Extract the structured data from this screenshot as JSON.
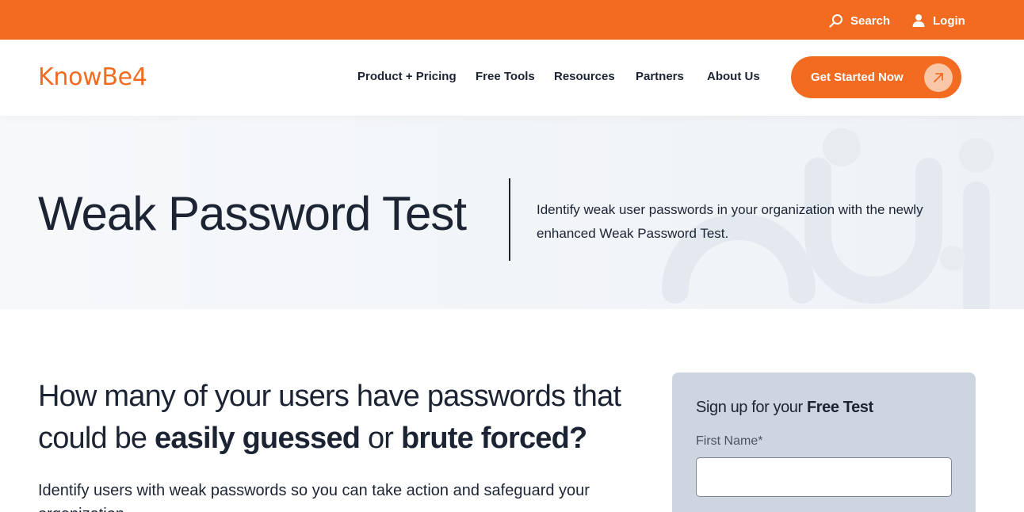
{
  "topbar": {
    "search_label": "Search",
    "login_label": "Login",
    "background": "#f26b21"
  },
  "header": {
    "logo_text": "KnowBe4",
    "nav": [
      {
        "label": "Product + Pricing"
      },
      {
        "label": "Free Tools"
      },
      {
        "label": "Resources"
      },
      {
        "label": "Partners"
      },
      {
        "label": "About Us"
      }
    ],
    "cta_label": "Get Started Now",
    "accent": "#f26b21"
  },
  "hero": {
    "title": "Weak Password Test",
    "description": "Identify weak user passwords in your organization with the newly enhanced Weak Password Test."
  },
  "main": {
    "question_part1": "How many of your users have passwords that could be ",
    "question_bold1": "easily guessed",
    "question_part2": " or ",
    "question_bold2": "brute forced?",
    "intro": "Identify users with weak passwords so you can take action and safeguard your organization."
  },
  "signup_form": {
    "heading_prefix": "Sign up for your ",
    "heading_bold": "Free Test",
    "first_name_label": "First Name*",
    "first_name_value": ""
  },
  "icons": {
    "search": "search-icon",
    "login": "user-icon",
    "cta": "arrow-up-right-icon"
  }
}
